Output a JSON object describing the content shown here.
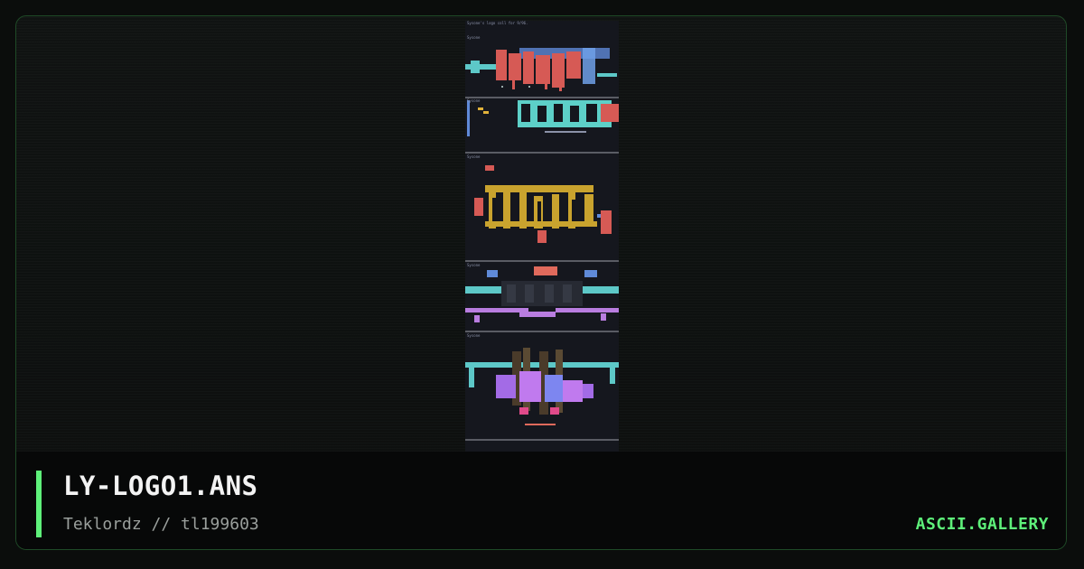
{
  "artwork": {
    "header_text": "Sysone's logo coll for 9/96.",
    "section_labels": [
      "Sysone",
      "Sysone",
      "Sysone",
      "Sysone",
      "Sysone"
    ]
  },
  "caption": {
    "title": "LY-LOGO1.ANS",
    "subtitle": "Teklordz // tl199603",
    "brand": "ASCII.GALLERY"
  },
  "colors": {
    "accent": "#5ef07a",
    "frame_border": "#1f4a27",
    "background": "#0b0d0c"
  }
}
